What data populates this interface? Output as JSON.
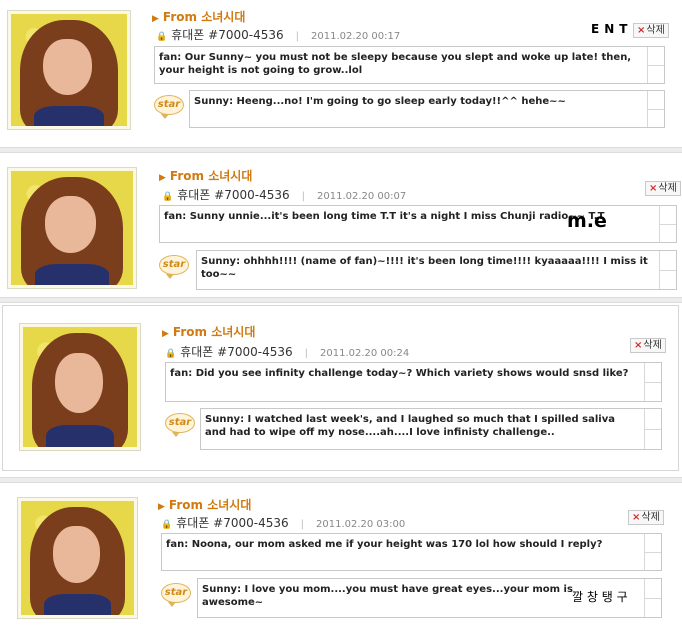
{
  "posts": [
    {
      "from_label": "From 소녀시대",
      "phone": "휴대폰 #7000-4536",
      "date": "2011.02.20 00:17",
      "delete_label": "삭제",
      "fan_message": "fan: Our Sunny~ you must not be sleepy because you slept and woke up late! then, your height is not going to grow..lol",
      "reply_badge": "star",
      "reply": "Sunny: Heeng...no! I'm going to go sleep early today!!^^ hehe~~",
      "overlay": "ENT"
    },
    {
      "from_label": "From 소녀시대",
      "phone": "휴대폰 #7000-4536",
      "date": "2011.02.20 00:07",
      "delete_label": "삭제",
      "fan_message": "fan: Sunny unnie...it's been long time T.T it's a night I miss Chunji radio~~ T.T",
      "reply_badge": "star",
      "reply": "Sunny: ohhhh!!!! (name of fan)~!!!! it's been long time!!!! kyaaaaa!!!! I miss it too~~",
      "overlay": "m.e"
    },
    {
      "from_label": "From 소녀시대",
      "phone": "휴대폰 #7000-4536",
      "date": "2011.02.20 00:24",
      "delete_label": "삭제",
      "fan_message": "fan: Did you see infinity challenge today~? Which variety shows would snsd like?",
      "reply_badge": "star",
      "reply": "Sunny: I watched last week's, and I laughed so much that I spilled saliva and had to wipe off my nose....ah....I love infinisty challenge..",
      "overlay": ""
    },
    {
      "from_label": "From 소녀시대",
      "phone": "휴대폰 #7000-4536",
      "date": "2011.02.20 03:00",
      "delete_label": "삭제",
      "fan_message": "fan: Noona, our mom asked me if your height was 170 lol how should I reply?",
      "reply_badge": "star",
      "reply": "Sunny: I love you mom....you must have great eyes...your mom is awesome~",
      "overlay": "깔 창 탱 구"
    }
  ],
  "colors": {
    "from_label": "#d07a10",
    "delete_x": "#d02a2a",
    "avatar_bg": "#e7d84a"
  }
}
